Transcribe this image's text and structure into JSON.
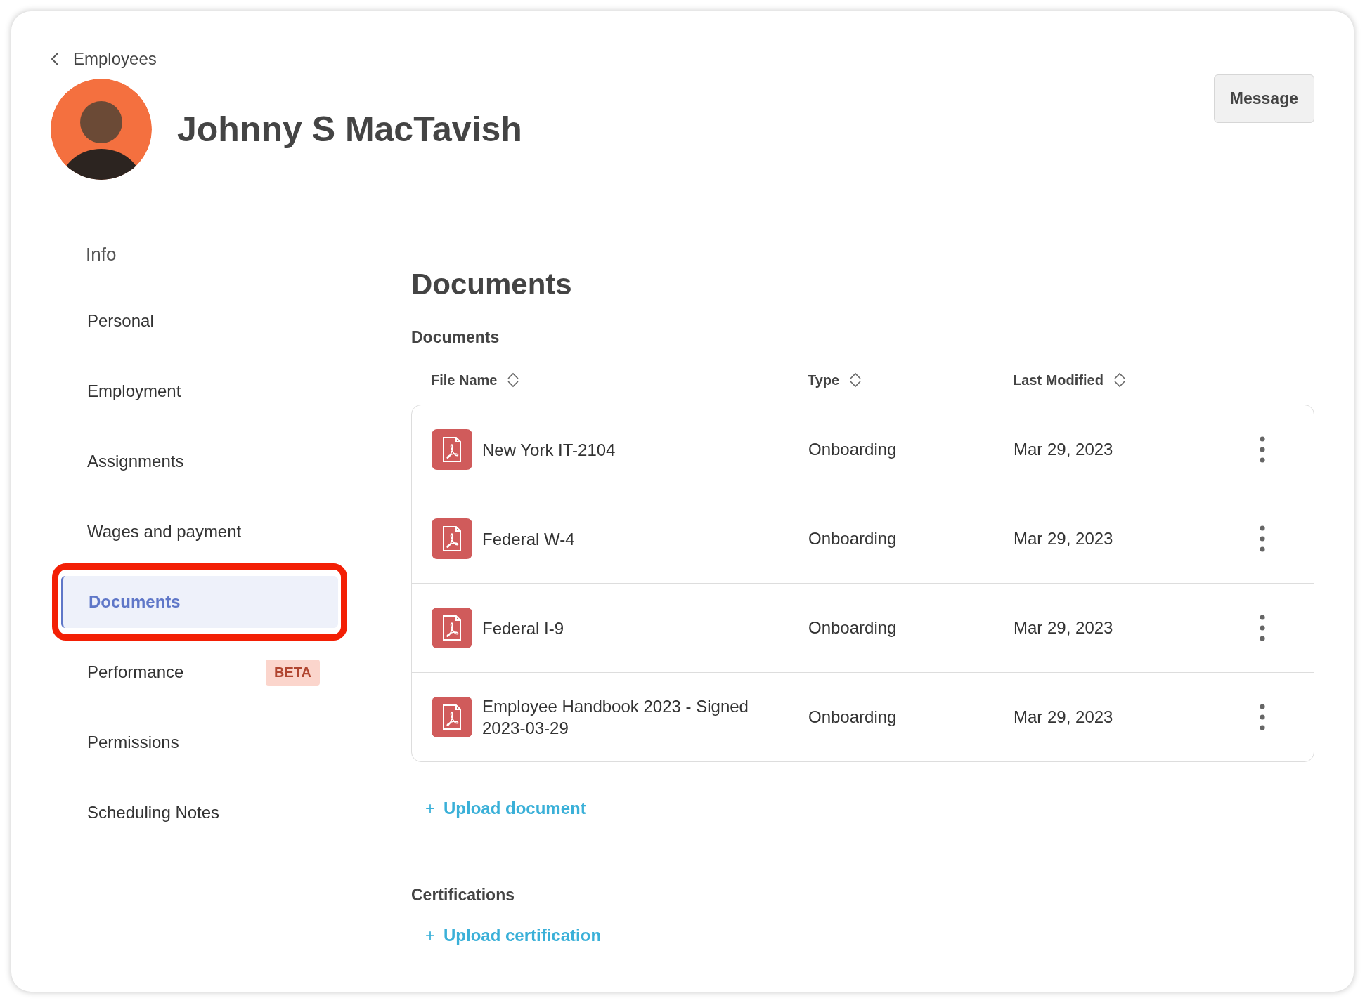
{
  "back_link": {
    "label": "Employees"
  },
  "employee": {
    "name": "Johnny S MacTavish"
  },
  "message_button": {
    "label": "Message"
  },
  "sidebar": {
    "heading": "Info",
    "items": [
      {
        "label": "Personal",
        "selected": false,
        "annotated": false
      },
      {
        "label": "Employment",
        "selected": false,
        "annotated": false
      },
      {
        "label": "Assignments",
        "selected": false,
        "annotated": false
      },
      {
        "label": "Wages and payment",
        "selected": false,
        "annotated": false
      },
      {
        "label": "Documents",
        "selected": true,
        "annotated": true
      },
      {
        "label": "Performance",
        "selected": false,
        "annotated": false,
        "badge": "BETA"
      },
      {
        "label": "Permissions",
        "selected": false,
        "annotated": false
      },
      {
        "label": "Scheduling Notes",
        "selected": false,
        "annotated": false
      }
    ]
  },
  "page_title": "Documents",
  "documents": {
    "heading": "Documents",
    "columns": [
      "File Name",
      "Type",
      "Last Modified"
    ],
    "rows": [
      {
        "file_name": "New York IT-2104",
        "type": "Onboarding",
        "last_modified": "Mar 29, 2023"
      },
      {
        "file_name": "Federal W-4",
        "type": "Onboarding",
        "last_modified": "Mar 29, 2023"
      },
      {
        "file_name": "Federal I-9",
        "type": "Onboarding",
        "last_modified": "Mar 29, 2023"
      },
      {
        "file_name": "Employee Handbook 2023 - Signed 2023-03-29",
        "type": "Onboarding",
        "last_modified": "Mar 29, 2023"
      }
    ],
    "upload": {
      "icon": "+",
      "label": "Upload document"
    }
  },
  "certifications": {
    "heading": "Certifications",
    "upload": {
      "icon": "+",
      "label": "Upload certification"
    }
  }
}
